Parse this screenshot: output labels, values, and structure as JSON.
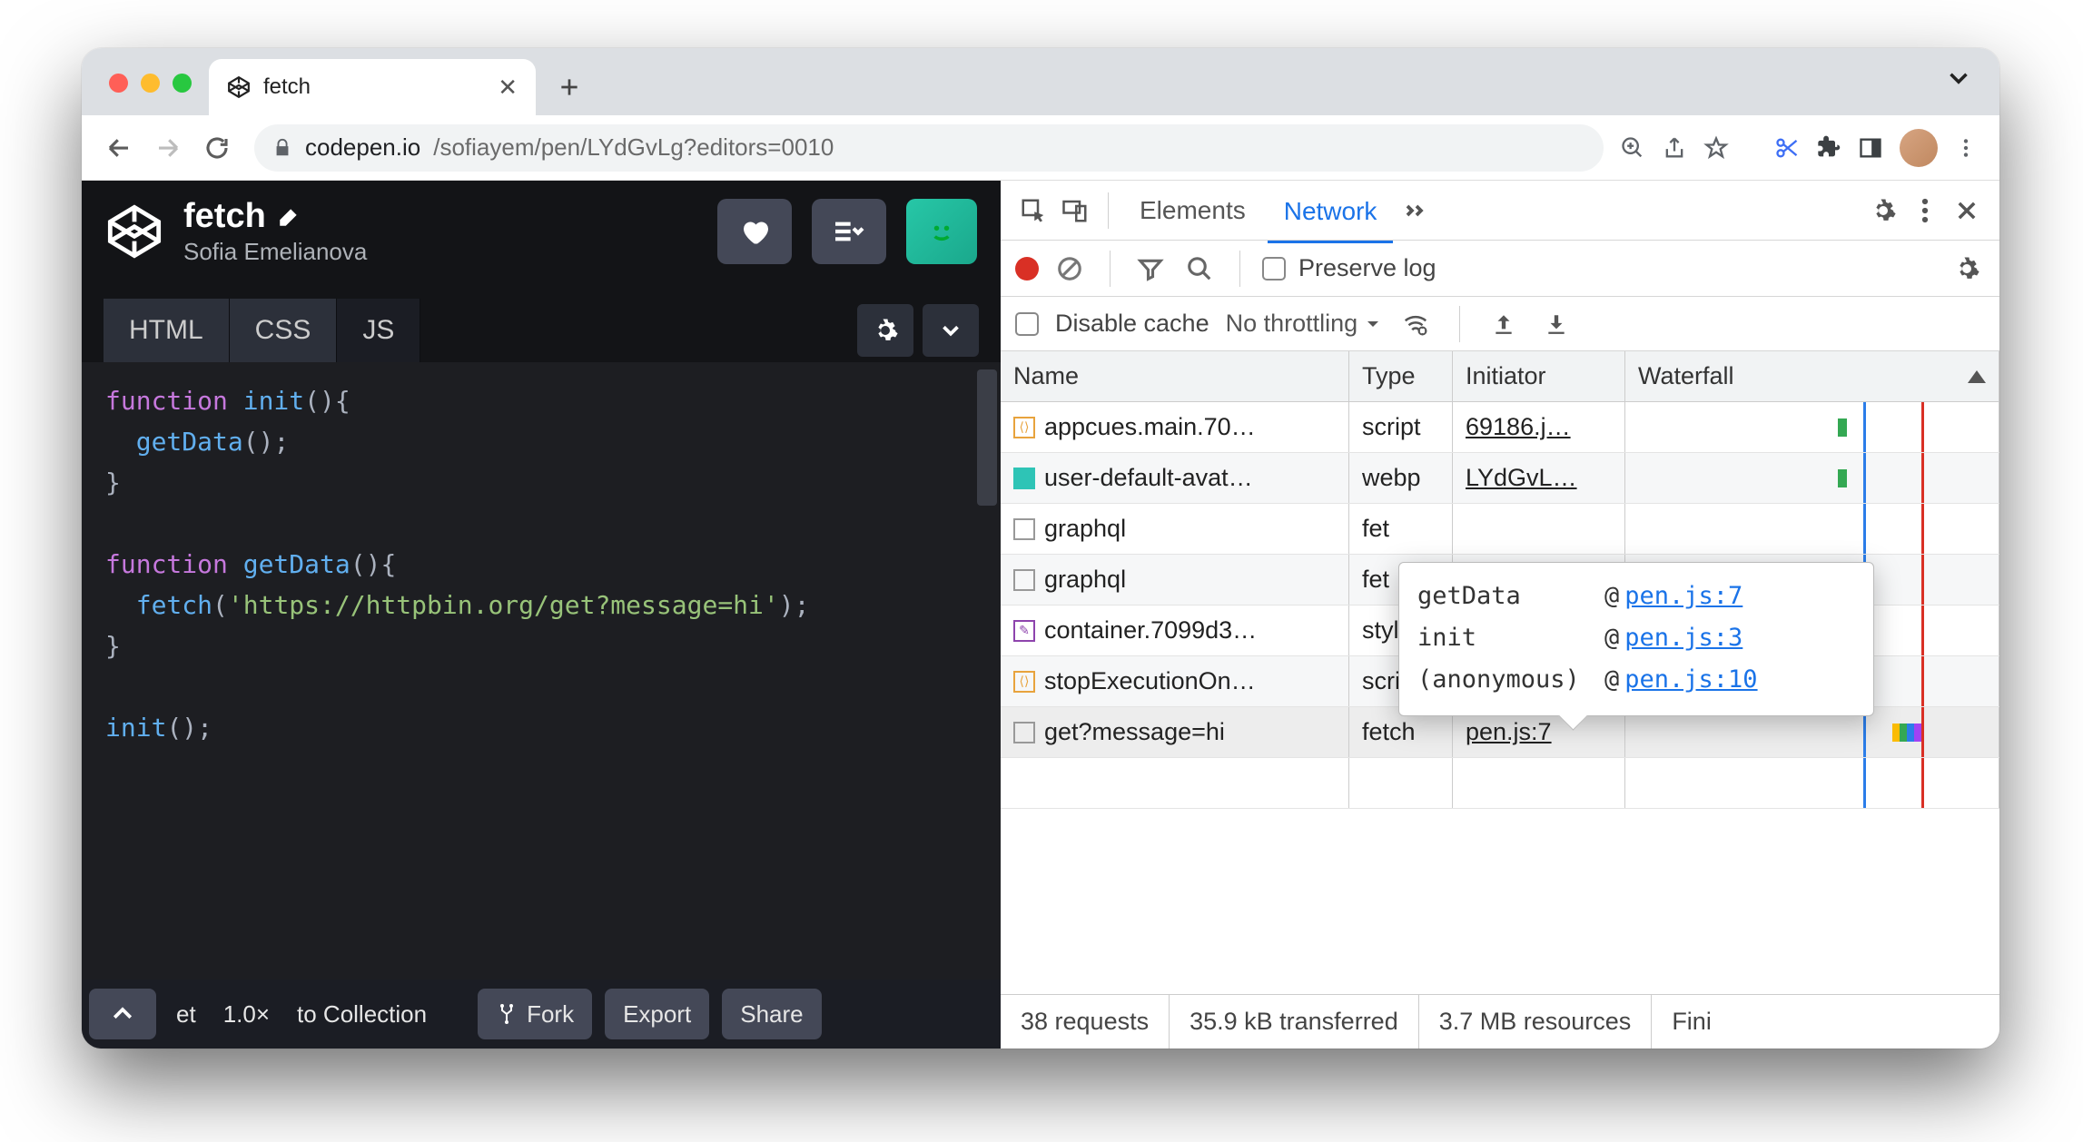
{
  "browser": {
    "tab_title": "fetch",
    "url_host": "codepen.io",
    "url_path": "/sofiayem/pen/LYdGvLg?editors=0010"
  },
  "codepen": {
    "title": "fetch",
    "author": "Sofia Emelianova",
    "tabs": {
      "html": "HTML",
      "css": "CSS",
      "js": "JS"
    },
    "code_lines": [
      {
        "t": "kw",
        "s": "function "
      },
      {
        "t": "fn",
        "s": "init"
      },
      {
        "t": "pun",
        "s": "(){"
      },
      {
        "t": "nl"
      },
      {
        "t": "pad",
        "s": "  "
      },
      {
        "t": "fn",
        "s": "getData"
      },
      {
        "t": "pun",
        "s": "();"
      },
      {
        "t": "nl"
      },
      {
        "t": "pun",
        "s": "}"
      },
      {
        "t": "nl"
      },
      {
        "t": "nl"
      },
      {
        "t": "kw",
        "s": "function "
      },
      {
        "t": "fn",
        "s": "getData"
      },
      {
        "t": "pun",
        "s": "(){"
      },
      {
        "t": "nl"
      },
      {
        "t": "pad",
        "s": "  "
      },
      {
        "t": "fn",
        "s": "fetch"
      },
      {
        "t": "pun",
        "s": "("
      },
      {
        "t": "str",
        "s": "'https://httpbin.org/get?message=hi'"
      },
      {
        "t": "pun",
        "s": ");"
      },
      {
        "t": "nl"
      },
      {
        "t": "pun",
        "s": "}"
      },
      {
        "t": "nl"
      },
      {
        "t": "nl"
      },
      {
        "t": "fn",
        "s": "init"
      },
      {
        "t": "pun",
        "s": "();"
      }
    ],
    "footer": {
      "zoom": "1.0×",
      "prefix": "et",
      "collection": "to Collection",
      "fork": "Fork",
      "export": "Export",
      "share": "Share"
    }
  },
  "devtools": {
    "tabs": {
      "elements": "Elements",
      "network": "Network"
    },
    "preserve_log": "Preserve log",
    "disable_cache": "Disable cache",
    "throttling": "No throttling",
    "columns": {
      "name": "Name",
      "type": "Type",
      "initiator": "Initiator",
      "waterfall": "Waterfall"
    },
    "rows": [
      {
        "icon": "js",
        "name": "appcues.main.70…",
        "type": "script",
        "initiator": "69186.j…"
      },
      {
        "icon": "img",
        "name": "user-default-avat…",
        "type": "webp",
        "initiator": "LYdGvL…"
      },
      {
        "icon": "doc",
        "name": "graphql",
        "type": "fet",
        "initiator": ""
      },
      {
        "icon": "doc",
        "name": "graphql",
        "type": "fet",
        "initiator": ""
      },
      {
        "icon": "css",
        "name": "container.7099d3…",
        "type": "styl",
        "initiator": ""
      },
      {
        "icon": "js",
        "name": "stopExecutionOn…",
        "type": "scrip",
        "initiator": ""
      },
      {
        "icon": "doc",
        "name": "get?message=hi",
        "type": "fetch",
        "initiator": "pen.js:7",
        "selected": true
      }
    ],
    "tooltip": [
      {
        "fn": "getData",
        "at": "@",
        "loc": "pen.js:7"
      },
      {
        "fn": "init",
        "at": "@",
        "loc": "pen.js:3"
      },
      {
        "fn": "(anonymous)",
        "at": "@",
        "loc": "pen.js:10"
      }
    ],
    "footer": {
      "requests": "38 requests",
      "transferred": "35.9 kB transferred",
      "resources": "3.7 MB resources",
      "finish": "Fini"
    }
  }
}
